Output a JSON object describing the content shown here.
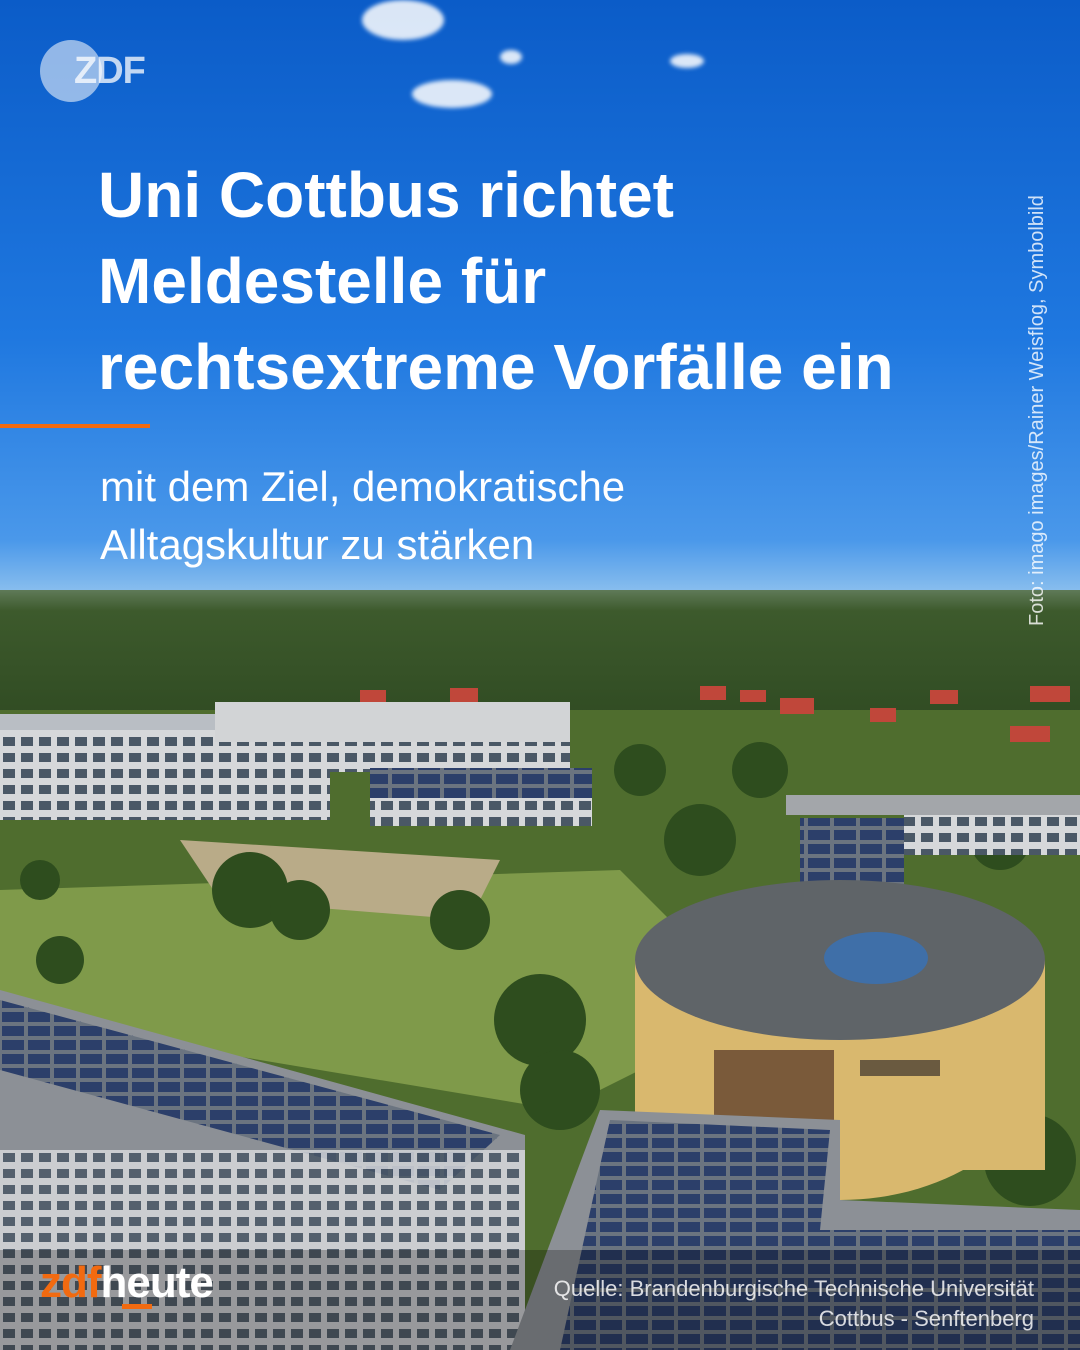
{
  "brand": {
    "logo_text": "ZDF",
    "wordmark_zdf": "zdf",
    "wordmark_heute": "heute"
  },
  "headline": {
    "lines": [
      "Uni Cottbus richtet",
      "Meldestelle für",
      "rechtsextreme Vorfälle ein"
    ]
  },
  "subline": {
    "lines": [
      "mit dem Ziel, demokratische",
      "Alltagskultur zu stärken"
    ]
  },
  "photo_credit": "Foto: imago images/Rainer Weisflog, Symbolbild",
  "source": {
    "lines": [
      "Quelle: Brandenburgische Technische Universität",
      "Cottbus - Senftenberg"
    ]
  },
  "colors": {
    "accent": "#f26a10",
    "sky": "#1f78e0",
    "text": "#ffffff"
  },
  "icons": [
    "zdf-logo-icon"
  ]
}
